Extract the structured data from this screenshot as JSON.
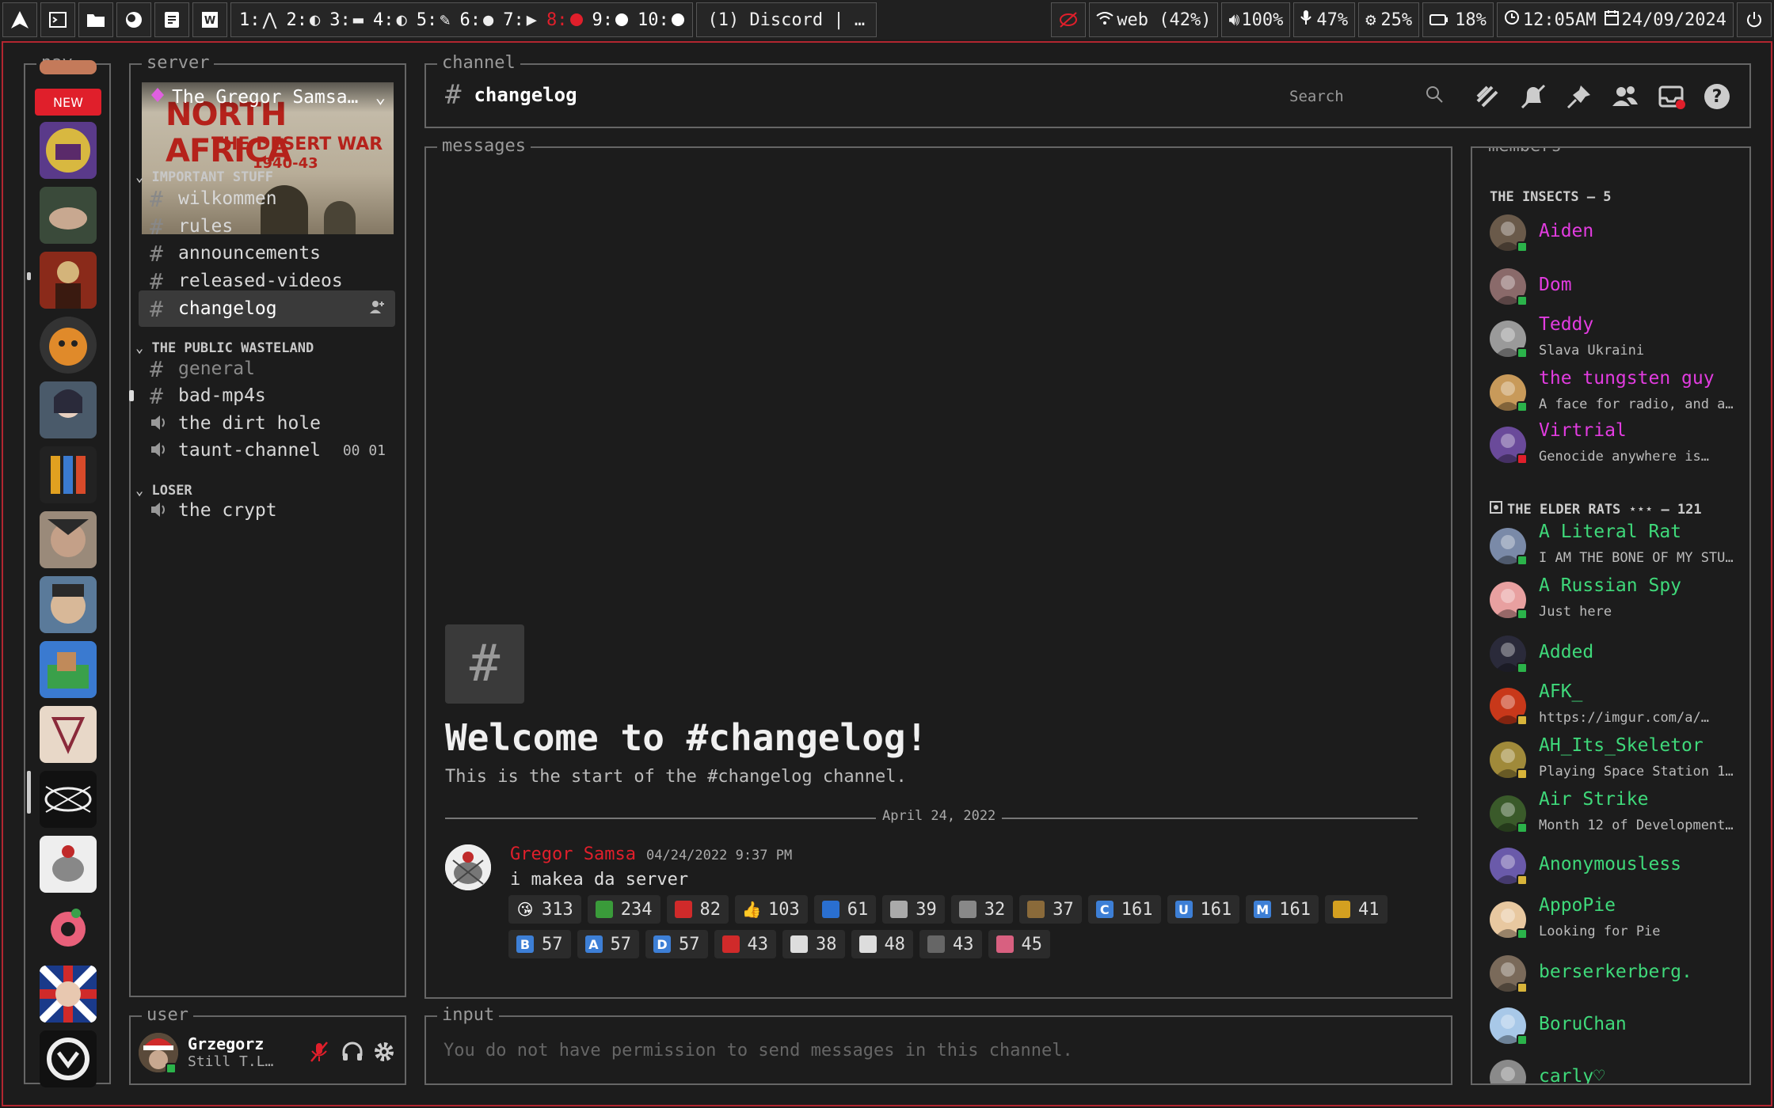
{
  "topbar": {
    "workspaces": [
      {
        "num": "1:",
        "icon": "arch-icon",
        "glyph": "⋀"
      },
      {
        "num": "2:",
        "icon": "moon-icon",
        "glyph": "◐"
      },
      {
        "num": "3:",
        "icon": "folder-icon",
        "glyph": "▬"
      },
      {
        "num": "4:",
        "icon": "moon-icon",
        "glyph": "◐"
      },
      {
        "num": "5:",
        "icon": "edit-icon",
        "glyph": "✎"
      },
      {
        "num": "6:",
        "icon": "chat-icon",
        "glyph": "●"
      },
      {
        "num": "7:",
        "icon": "video-icon",
        "glyph": "▶"
      },
      {
        "num": "8:",
        "icon": "dot-icon",
        "glyph": ""
      },
      {
        "num": "9:",
        "icon": "dot-icon",
        "glyph": ""
      },
      {
        "num": "10:",
        "icon": "dot-icon",
        "glyph": ""
      }
    ],
    "window_title": "(1) Discord | …",
    "wifi": "web (42%)",
    "volume": "100%",
    "mic": "47%",
    "brightness": "25%",
    "battery": "18%",
    "time": "12:05AM",
    "date": "24/09/2024"
  },
  "nav": {
    "label": "nav",
    "new_badge": "NEW"
  },
  "server": {
    "label": "server",
    "name": "The Gregor Samsa…",
    "banner_line1": "NORTH AFRICA",
    "banner_line2": "THE DESERT WAR",
    "banner_line3": "1940-43",
    "categories": [
      {
        "name": "IMPORTANT STUFF"
      },
      {
        "name": "THE PUBLIC WASTELAND"
      },
      {
        "name": "LOSER"
      }
    ],
    "channels": [
      {
        "name": "wilkommen",
        "type": "text"
      },
      {
        "name": "rules",
        "type": "text"
      },
      {
        "name": "announcements",
        "type": "text"
      },
      {
        "name": "released-videos",
        "type": "text"
      },
      {
        "name": "changelog",
        "type": "text"
      },
      {
        "name": "general",
        "type": "text"
      },
      {
        "name": "bad-mp4s",
        "type": "text"
      },
      {
        "name": "the dirt hole",
        "type": "voice"
      },
      {
        "name": "taunt-channel",
        "type": "voice",
        "extra": "00 01"
      },
      {
        "name": "the crypt",
        "type": "voice"
      }
    ]
  },
  "user": {
    "label": "user",
    "name": "Grzegorz",
    "status": "Still T.L…"
  },
  "channel": {
    "label": "channel",
    "name": "changelog",
    "search_placeholder": "Search"
  },
  "messages": {
    "label": "messages",
    "welcome_title": "Welcome to #changelog!",
    "welcome_sub": "This is the start of the #changelog channel.",
    "date_divider": "April 24, 2022",
    "author": "Gregor Samsa",
    "timestamp": "04/24/2022 9:37 PM",
    "text": "i makea da server",
    "reactions": [
      {
        "emoji": "😘",
        "count": "313",
        "color": "#f5b82e"
      },
      {
        "emoji": "",
        "count": "234",
        "color": "#3a9b3a"
      },
      {
        "emoji": "",
        "count": "82",
        "color": "#d02a2a"
      },
      {
        "emoji": "👍",
        "count": "103",
        "color": "#f5b82e"
      },
      {
        "emoji": "",
        "count": "61",
        "color": "#2a6fd0"
      },
      {
        "emoji": "",
        "count": "39",
        "color": "#aaaaaa"
      },
      {
        "emoji": "",
        "count": "32",
        "color": "#888888"
      },
      {
        "emoji": "",
        "count": "37",
        "color": "#8a6a3a"
      },
      {
        "emoji": "C",
        "count": "161",
        "color": "#3d7fd6"
      },
      {
        "emoji": "U",
        "count": "161",
        "color": "#3d7fd6"
      },
      {
        "emoji": "M",
        "count": "161",
        "color": "#3d7fd6"
      },
      {
        "emoji": "",
        "count": "41",
        "color": "#d4a020"
      },
      {
        "emoji": "B",
        "count": "57",
        "color": "#3d7fd6"
      },
      {
        "emoji": "A",
        "count": "57",
        "color": "#3d7fd6"
      },
      {
        "emoji": "D",
        "count": "57",
        "color": "#3d7fd6"
      },
      {
        "emoji": "",
        "count": "43",
        "color": "#d02a2a"
      },
      {
        "emoji": "",
        "count": "38",
        "color": "#dddddd"
      },
      {
        "emoji": "",
        "count": "48",
        "color": "#dddddd"
      },
      {
        "emoji": "",
        "count": "43",
        "color": "#666666"
      },
      {
        "emoji": "",
        "count": "45",
        "color": "#d86080"
      }
    ]
  },
  "input": {
    "label": "input",
    "placeholder": "You do not have permission to send messages in this channel."
  },
  "members": {
    "label": "members",
    "groups": [
      {
        "name": "THE INSECTS — 5"
      },
      {
        "name": "THE ELDER RATS ⋆⋆⋆ — 121"
      }
    ],
    "list": [
      {
        "name": "Aiden",
        "sub": "",
        "color": "mag",
        "status": "online"
      },
      {
        "name": "Dom",
        "sub": "",
        "color": "mag",
        "status": "online"
      },
      {
        "name": "Teddy",
        "sub": "Slava Ukraini",
        "color": "mag",
        "status": "online"
      },
      {
        "name": "the tungsten guy",
        "sub": "A face for radio, and a…",
        "color": "mag",
        "status": "online"
      },
      {
        "name": "Virtrial",
        "sub": "Genocide anywhere is…",
        "color": "mag",
        "status": "dnd"
      },
      {
        "name": "A Literal Rat",
        "sub": "I AM THE BONE OF MY STU…",
        "color": "grn",
        "status": "online"
      },
      {
        "name": "A Russian Spy",
        "sub": "Just here",
        "color": "grn",
        "status": "online"
      },
      {
        "name": "Added",
        "sub": "",
        "color": "grn",
        "status": "online"
      },
      {
        "name": "AFK_",
        "sub": "https://imgur.com/a/…",
        "color": "grn",
        "status": "idle"
      },
      {
        "name": "AH_Its_Skeletor",
        "sub": "Playing Space Station 1…",
        "color": "grn",
        "status": "idle"
      },
      {
        "name": "Air Strike",
        "sub": "Month 12 of Development…",
        "color": "grn",
        "status": "online"
      },
      {
        "name": "Anonymousless",
        "sub": "",
        "color": "grn",
        "status": "idle"
      },
      {
        "name": "AppoPie",
        "sub": "Looking for Pie",
        "color": "grn",
        "status": "online"
      },
      {
        "name": "berserkerberg.",
        "sub": "",
        "color": "grn",
        "status": "idle"
      },
      {
        "name": "BoruChan",
        "sub": "",
        "color": "grn",
        "status": "online"
      },
      {
        "name": "carly♡",
        "sub": "",
        "color": "grn",
        "status": "online"
      }
    ]
  }
}
